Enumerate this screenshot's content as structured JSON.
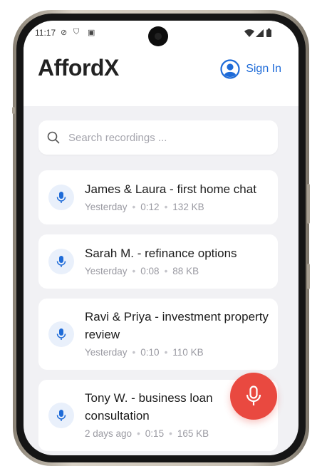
{
  "status_bar": {
    "time": "11:17"
  },
  "header": {
    "logo": "AffordX",
    "sign_in_label": "Sign In"
  },
  "search": {
    "placeholder": "Search recordings ..."
  },
  "recordings": [
    {
      "title": "James & Laura - first home chat",
      "date": "Yesterday",
      "duration": "0:12",
      "size": "132 KB"
    },
    {
      "title": "Sarah M. - refinance options",
      "date": "Yesterday",
      "duration": "0:08",
      "size": "88 KB"
    },
    {
      "title": "Ravi & Priya - investment property review",
      "date": "Yesterday",
      "duration": "0:10",
      "size": "110 KB"
    },
    {
      "title": "Tony W. - business loan consultation",
      "date": "2 days ago",
      "duration": "0:15",
      "size": "165 KB"
    }
  ],
  "colors": {
    "accent": "#1e6bd8",
    "record": "#e94940",
    "background": "#f1f1f4"
  }
}
